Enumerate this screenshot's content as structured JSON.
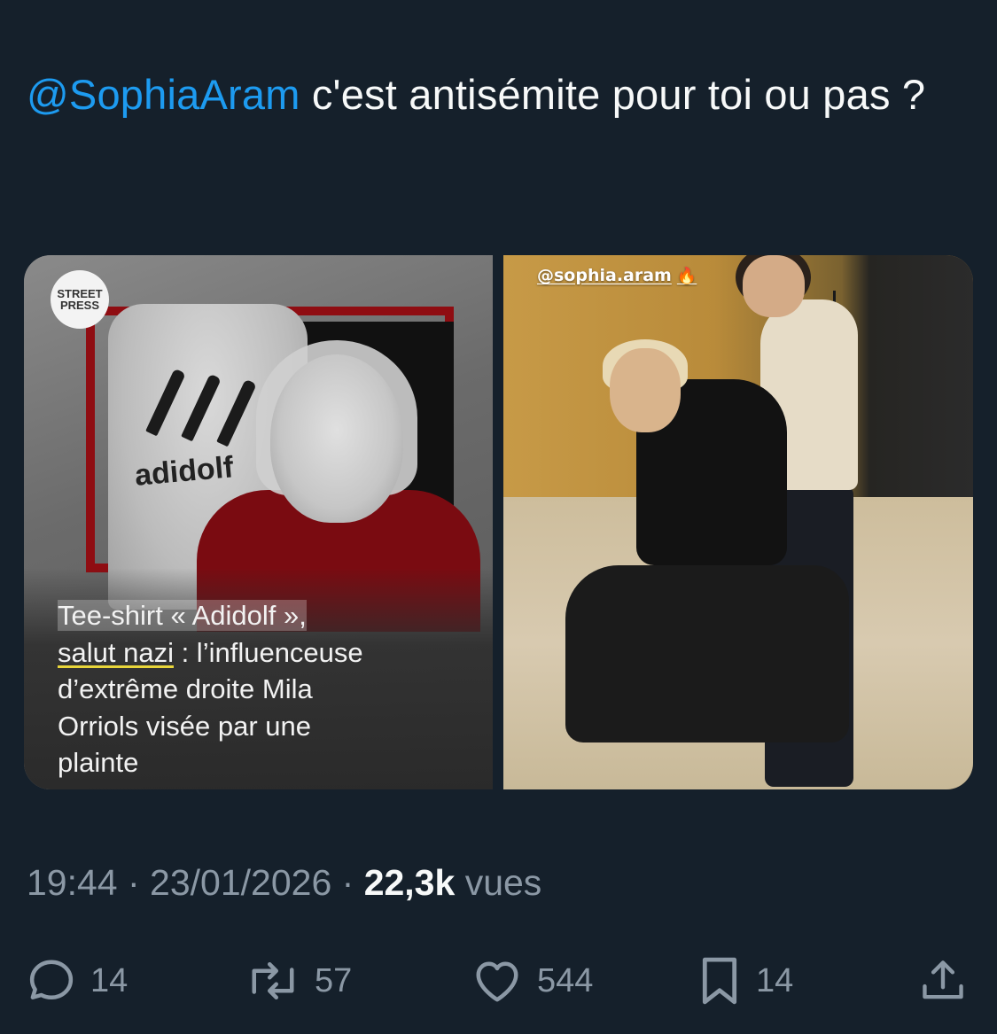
{
  "tweet": {
    "mention": "@SophiaAram",
    "text": " c'est antisémite pour toi ou pas ?"
  },
  "media": {
    "left": {
      "logo_line1": "STREET",
      "logo_line2": "PRESS",
      "shirt_text": "adidolf",
      "caption_line1": "Tee-shirt « Adidolf »,",
      "caption_line2_underlined": "salut nazi",
      "caption_line2_rest": " : l’influenceuse",
      "caption_line3": "d’extrême droite Mila",
      "caption_line4": "Orriols visée par une",
      "caption_line5": "plainte"
    },
    "right": {
      "story_tag": "@sophia.aram",
      "story_emoji": "🔥"
    }
  },
  "meta": {
    "time": "19:44",
    "sep1": " · ",
    "date": "23/01/2026",
    "sep2": " · ",
    "views_count": "22,3k",
    "views_label": " vues"
  },
  "actions": {
    "replies": "14",
    "reposts": "57",
    "likes": "544",
    "bookmarks": "14"
  },
  "colors": {
    "background": "#15202b",
    "mention": "#1d9bf0",
    "secondary_text": "#8b98a5",
    "primary_text": "#f7f9f9"
  },
  "icons": {
    "reply": "reply-icon",
    "repost": "repost-icon",
    "like": "like-icon",
    "bookmark": "bookmark-icon",
    "share": "share-icon"
  }
}
